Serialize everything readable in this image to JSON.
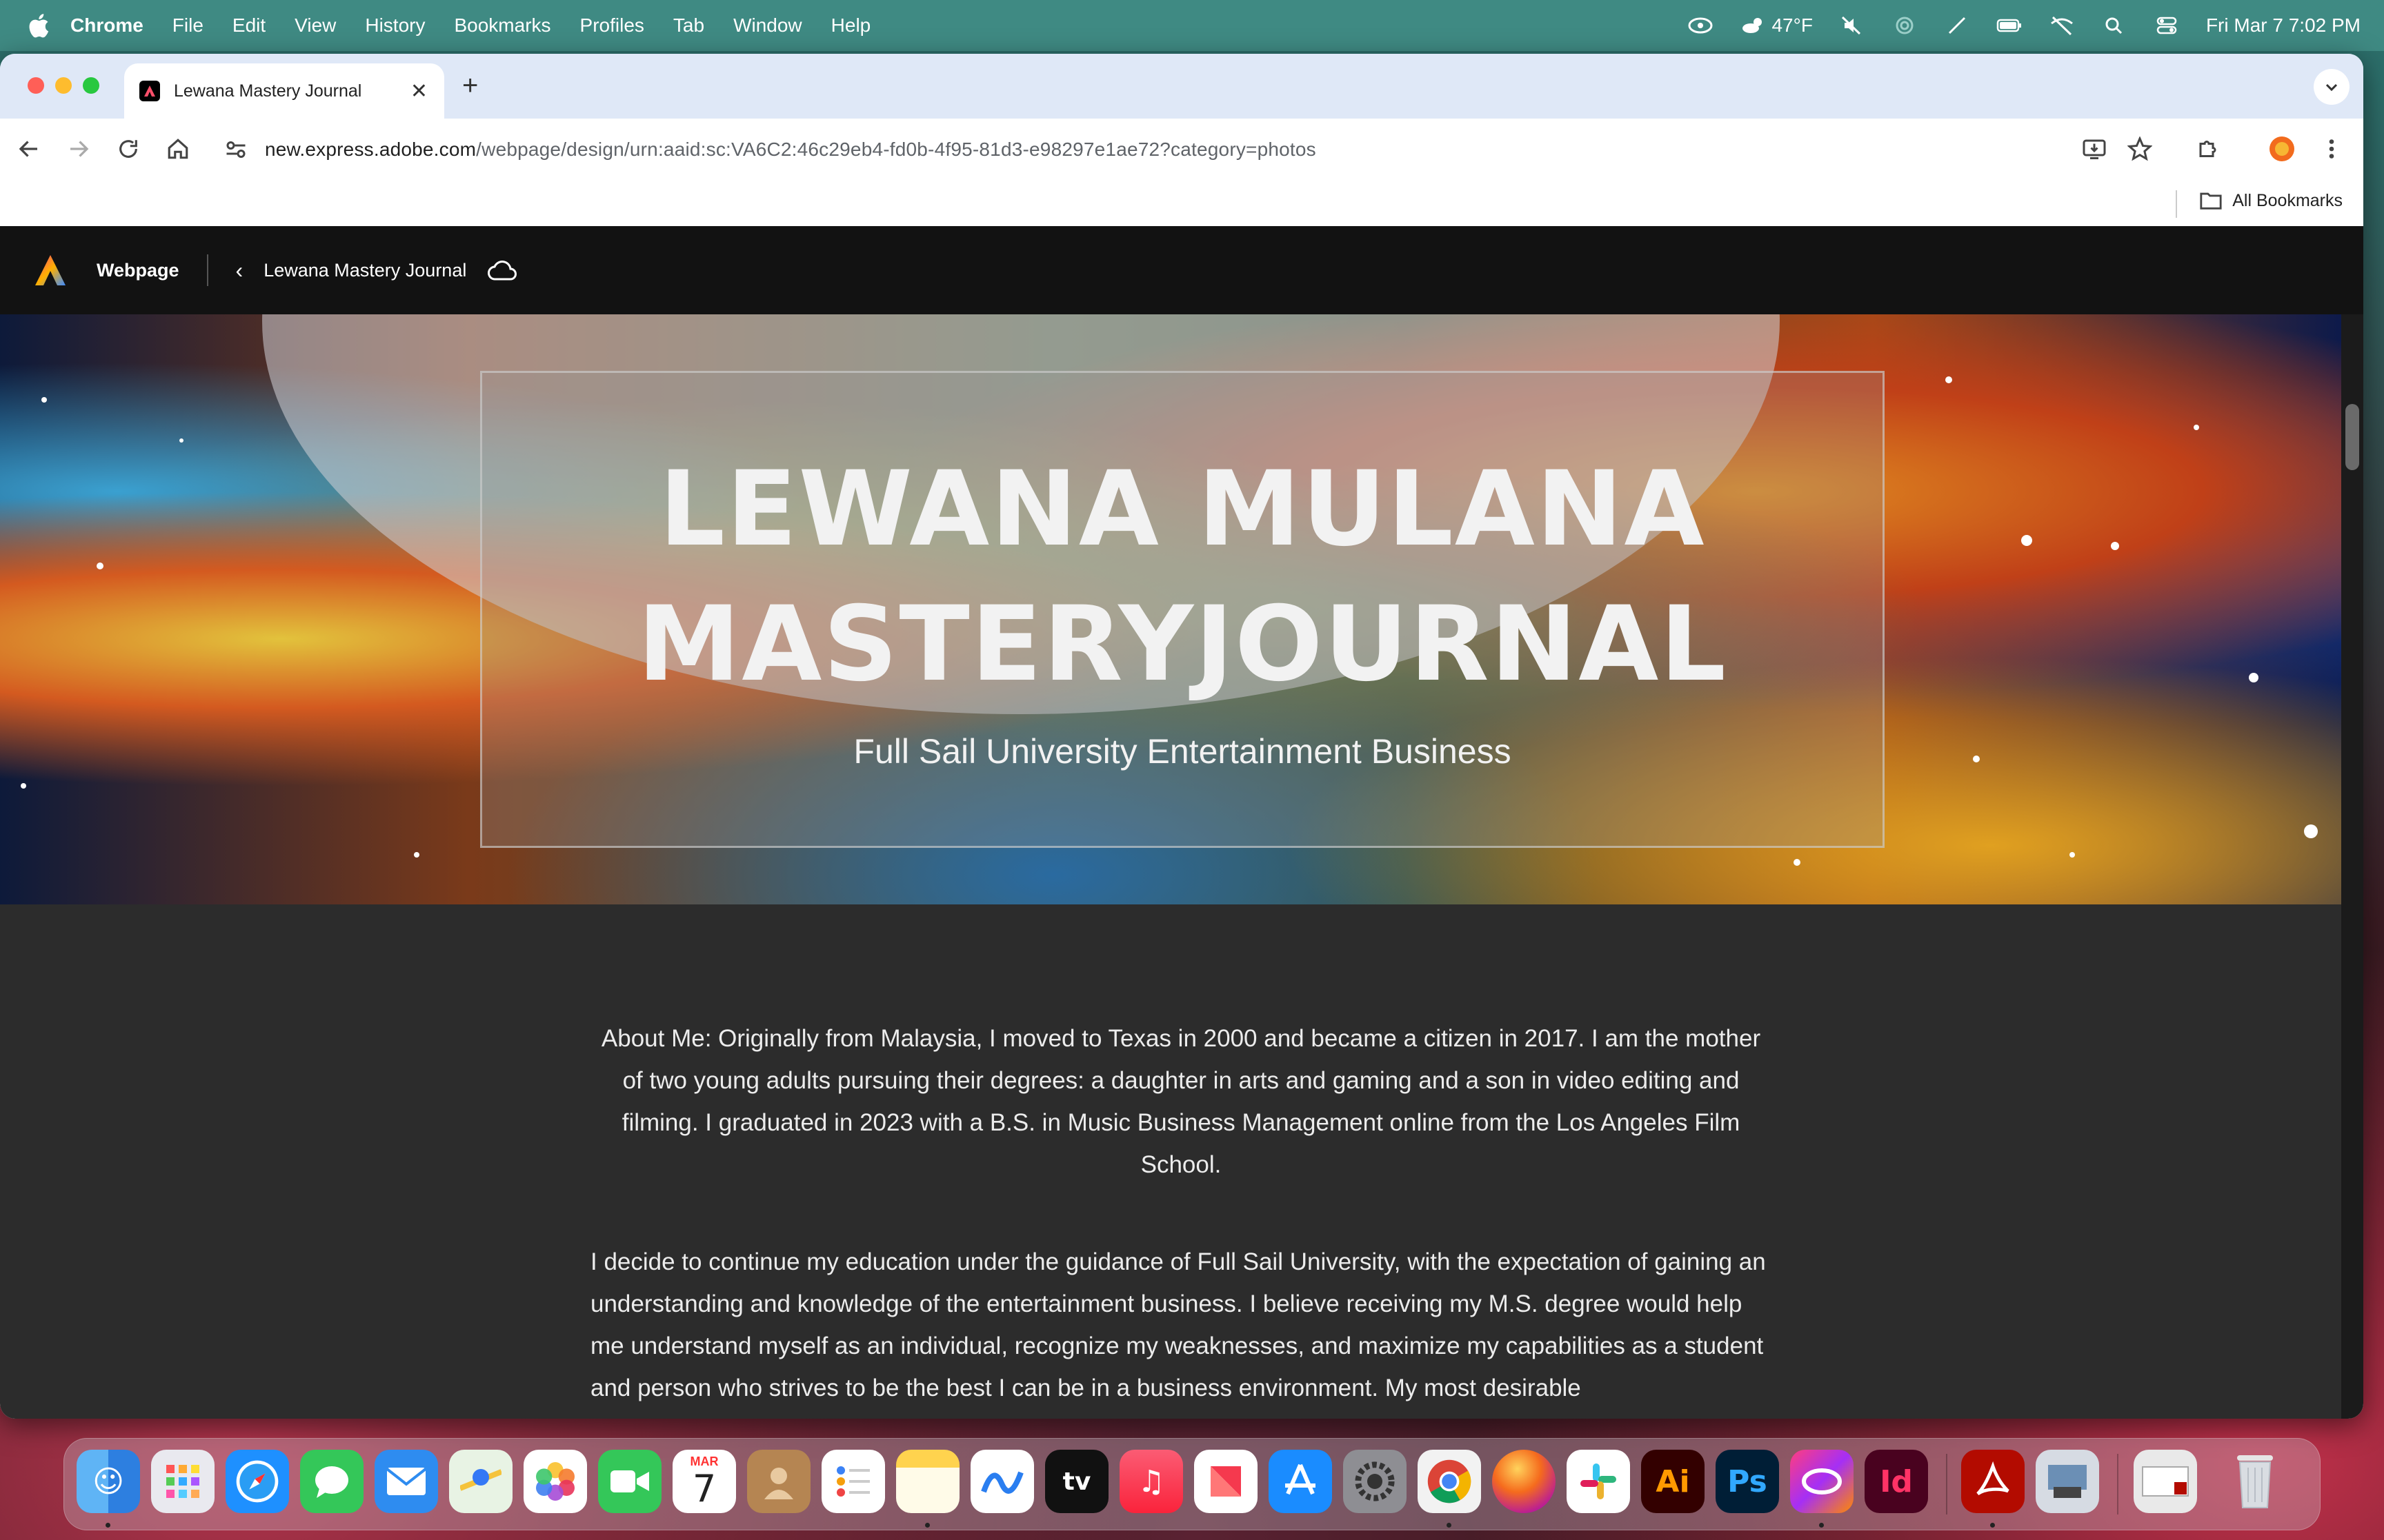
{
  "menubar": {
    "items": [
      "Chrome",
      "File",
      "Edit",
      "View",
      "History",
      "Bookmarks",
      "Profiles",
      "Tab",
      "Window",
      "Help"
    ],
    "weather": "47°F",
    "datetime": "Fri Mar 7  7:02 PM"
  },
  "browser": {
    "tab_title": "Lewana Mastery Journal",
    "url_host": "new.express.adobe.com",
    "url_path": "/webpage/design/urn:aaid:sc:VA6C2:46c29eb4-fd0b-4f95-81d3-e98297e1ae72?category=photos",
    "all_bookmarks": "All Bookmarks"
  },
  "app": {
    "section": "Webpage",
    "document_title": "Lewana Mastery Journal"
  },
  "hero": {
    "title_line1": "LEWANA MULANA",
    "title_line2": "MASTERYJOURNAL",
    "subtitle": "Full Sail University Entertainment Business"
  },
  "content": {
    "para1": "About Me: Originally from Malaysia, I moved to Texas in 2000 and became a citizen in 2017. I am the mother of two young adults pursuing their degrees: a daughter in arts and gaming and a son in video editing and filming. I graduated in 2023 with a B.S. in Music Business Management online from the Los Angeles Film School.",
    "para2": "I decide to continue my education under the guidance of Full Sail University, with the expectation of gaining an understanding and knowledge of the entertainment business. I believe receiving my M.S. degree would help me understand myself as an individual, recognize my weaknesses, and maximize my capabilities as a student and person who strives to be the best I can be in a business environment. My most desirable"
  },
  "dock": {
    "calendar_month": "MAR",
    "calendar_day": "7",
    "tv_label": "tv",
    "ai_label": "Ai",
    "ps_label": "Ps",
    "id_label": "Id"
  }
}
